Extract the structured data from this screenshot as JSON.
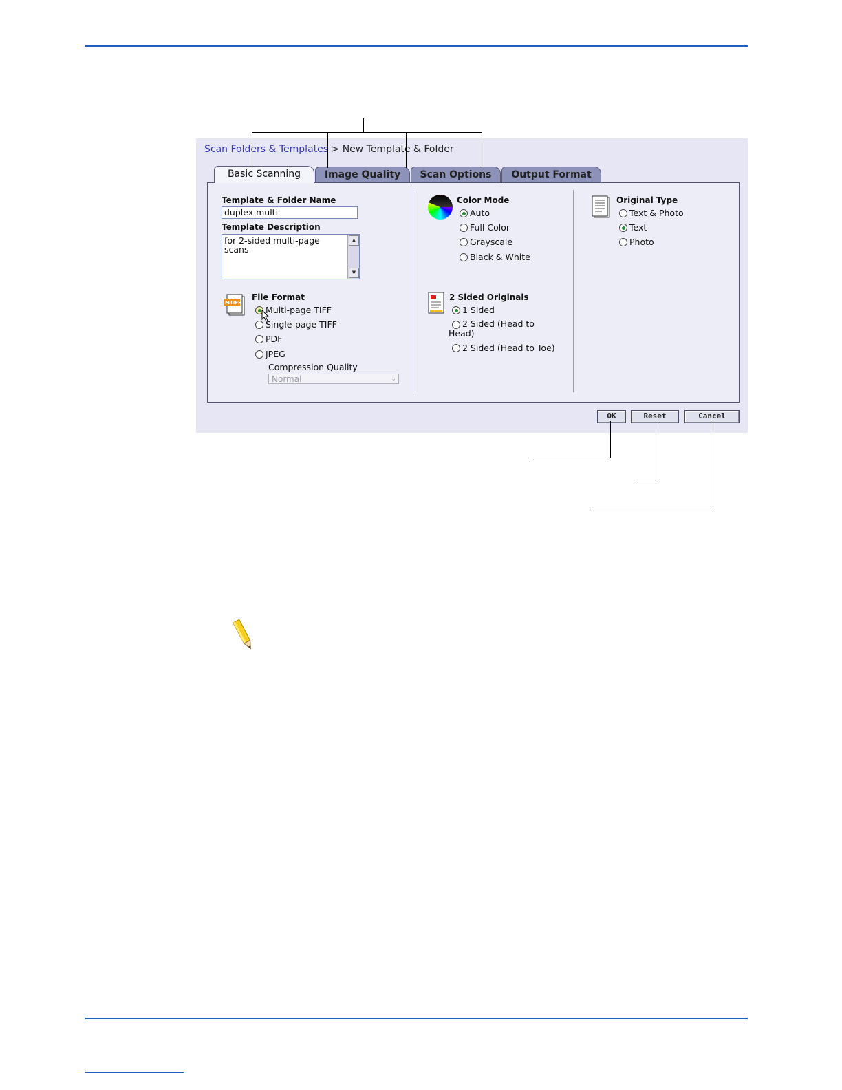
{
  "breadcrumb": {
    "link": "Scan Folders & Templates",
    "separator": ">",
    "current": "New Template & Folder"
  },
  "tabs": [
    {
      "label": "Basic Scanning",
      "active": true
    },
    {
      "label": "Image Quality",
      "active": false
    },
    {
      "label": "Scan Options",
      "active": false
    },
    {
      "label": "Output Format",
      "active": false
    }
  ],
  "basic": {
    "name_label": "Template & Folder Name",
    "name_value": "duplex multi",
    "desc_label": "Template Description",
    "desc_value": "for 2-sided multi-page scans",
    "file_format": {
      "label": "File Format",
      "icon_text": "MTIFF",
      "options": [
        "Multi-page TIFF",
        "Single-page TIFF",
        "PDF",
        "JPEG"
      ],
      "selected": "Multi-page TIFF",
      "compression_label": "Compression Quality",
      "compression_value": "Normal"
    },
    "color_mode": {
      "label": "Color Mode",
      "options": [
        "Auto",
        "Full Color",
        "Grayscale",
        "Black & White"
      ],
      "selected": "Auto"
    },
    "two_sided": {
      "label": "2 Sided Originals",
      "options": [
        "1 Sided",
        "2 Sided (Head to Head)",
        "2 Sided (Head to Toe)"
      ],
      "selected": "1 Sided"
    },
    "original_type": {
      "label": "Original Type",
      "options": [
        "Text & Photo",
        "Text",
        "Photo"
      ],
      "selected": "Text"
    }
  },
  "buttons": {
    "ok": "OK",
    "reset": "Reset",
    "cancel": "Cancel"
  },
  "colors": {
    "accent_rule": "#1f5fbf",
    "panel": "#e6e6f5",
    "tab_inactive": "#8d93b8"
  },
  "icons": [
    "color-wheel-icon",
    "document-icon",
    "tiff-file-icon",
    "two-sided-icon",
    "pencil-note-icon",
    "mouse-cursor-icon"
  ]
}
